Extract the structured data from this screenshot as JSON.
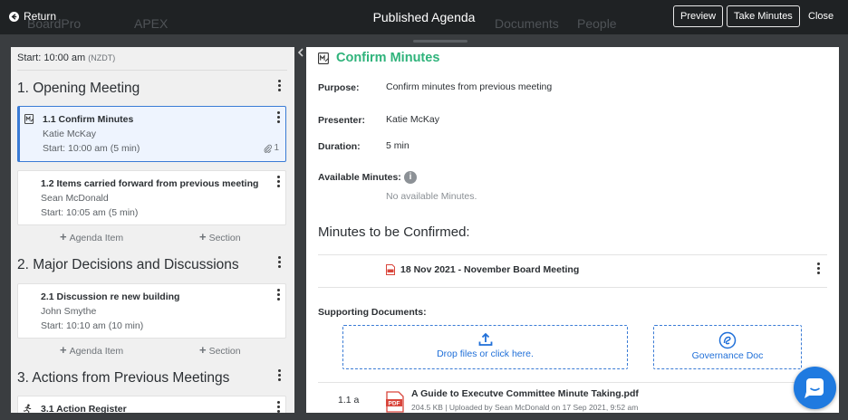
{
  "topbar": {
    "return_label": "Return",
    "title": "Published Agenda",
    "preview_label": "Preview",
    "take_minutes_label": "Take Minutes",
    "close_label": "Close",
    "background_nav": [
      "BoardPro",
      "APEX",
      "Documents",
      "People"
    ]
  },
  "agenda": {
    "start_label": "Start: 10:00 am",
    "timezone": "(NZDT)",
    "add_item_label": "Agenda Item",
    "add_section_label": "Section",
    "sections": [
      {
        "title": "1. Opening Meeting",
        "items": [
          {
            "title": "1.1 Confirm Minutes",
            "presenter": "Katie McKay",
            "start": "Start: 10:00 am (5 min)",
            "attachments": "1",
            "icon": "minutes-icon",
            "active": true
          },
          {
            "title": "1.2 Items carried forward from previous meeting",
            "presenter": "Sean McDonald",
            "start": "Start: 10:05 am (5 min)"
          }
        ]
      },
      {
        "title": "2. Major Decisions and Discussions",
        "items": [
          {
            "title": "2.1 Discussion re new building",
            "presenter": "John Smythe",
            "start": "Start: 10:10 am (10 min)"
          }
        ]
      },
      {
        "title": "3. Actions from Previous Meetings",
        "items": [
          {
            "title": "3.1 Action Register",
            "icon": "action-runner-icon"
          }
        ]
      }
    ]
  },
  "detail": {
    "title": "Confirm Minutes",
    "purpose_label": "Purpose:",
    "purpose": "Confirm minutes from previous meeting",
    "presenter_label": "Presenter:",
    "presenter": "Katie McKay",
    "duration_label": "Duration:",
    "duration": "5 min",
    "available_minutes_label": "Available Minutes:",
    "available_minutes_empty": "No available Minutes.",
    "minutes_heading": "Minutes to be Confirmed:",
    "minutes_entry": "18 Nov 2021 - November Board Meeting",
    "supporting_label": "Supporting Documents:",
    "dropzone_label": "Drop files or click here.",
    "governance_label": "Governance Doc",
    "document": {
      "number": "1.1 a",
      "title": "A Guide to Executve Committee Minute Taking.pdf",
      "meta": "204.5 KB | Uploaded by Sean McDonald on 17 Sep 2021, 9:52 am"
    }
  },
  "colors": {
    "accent_green": "#2fb37b",
    "accent_blue": "#3a7bd5",
    "topbar": "#1f2224",
    "chat": "#1f7ae0",
    "pdf_red": "#d9453b"
  }
}
